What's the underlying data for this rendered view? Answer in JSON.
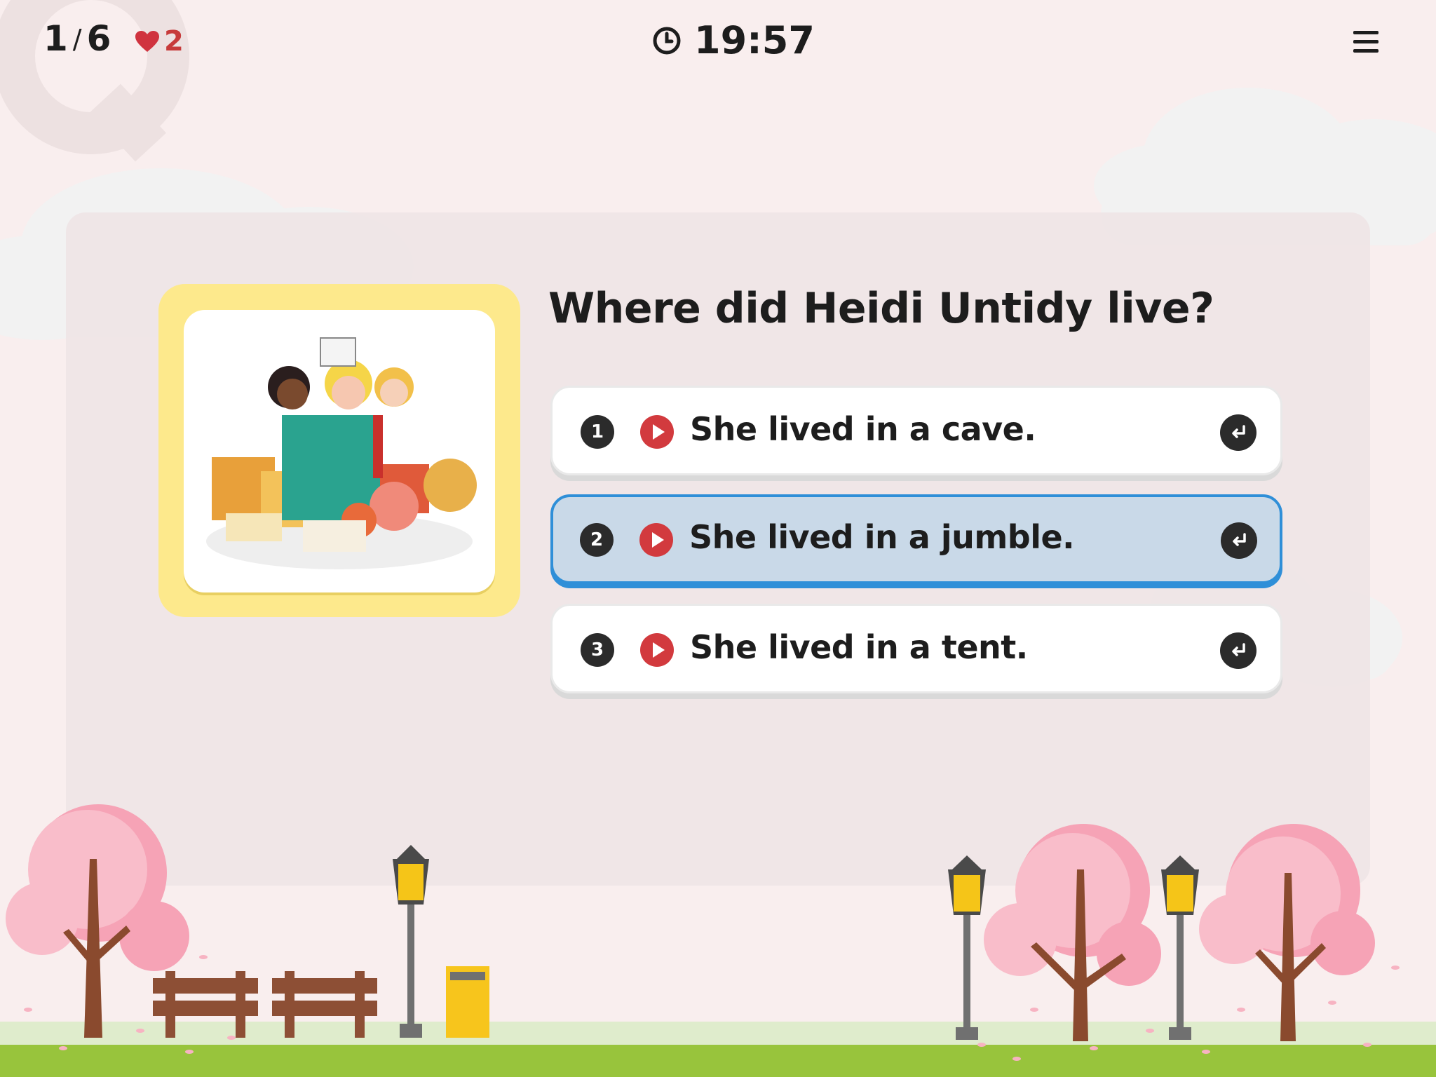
{
  "header": {
    "progress_current": "1",
    "progress_separator": "/",
    "progress_total": "6",
    "lives": "2",
    "timer": "19:57"
  },
  "question": {
    "text": "Where did Heidi Untidy live?"
  },
  "options": [
    {
      "number": "1",
      "text": "She lived in a cave.",
      "selected": false
    },
    {
      "number": "2",
      "text": "She lived in a jumble.",
      "selected": true
    },
    {
      "number": "3",
      "text": "She lived in a tent.",
      "selected": false
    }
  ],
  "icons": {
    "lives": "heart-icon",
    "timer": "clock-icon",
    "menu": "hamburger-menu-icon",
    "play": "play-audio-icon",
    "submit": "enter-arrow-icon"
  },
  "colors": {
    "background": "#f9eeee",
    "selected_border": "#2f8fd8",
    "selected_fill": "#c9d9e8",
    "heart": "#d0333f",
    "image_frame": "#fde98c"
  }
}
